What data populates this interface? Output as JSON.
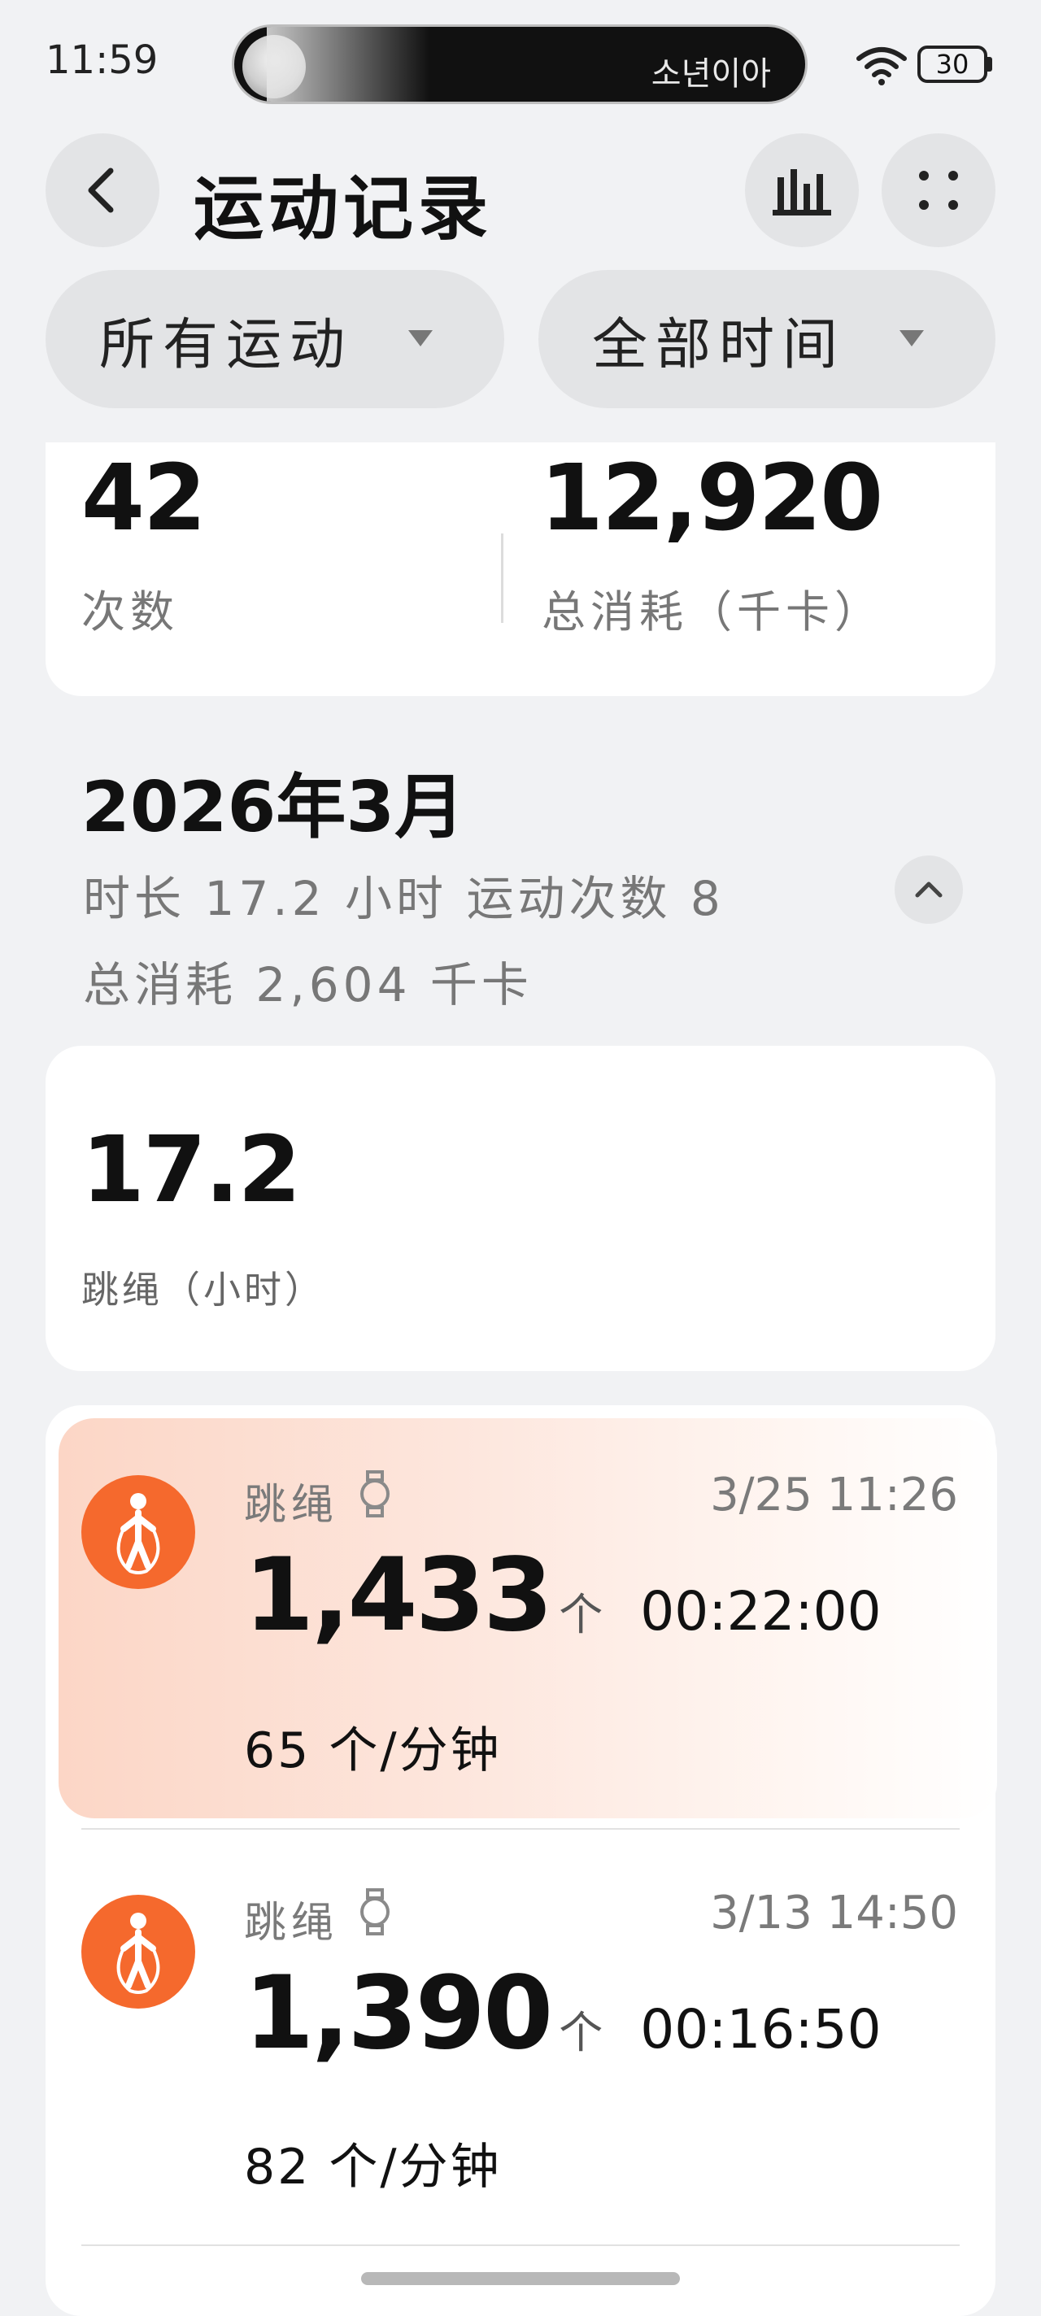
{
  "status_bar": {
    "time": "11:59",
    "island_text": "소년이아",
    "battery": "30"
  },
  "header": {
    "title": "运动记录",
    "back_icon": "chevron-left-icon",
    "chart_icon": "bar-chart-icon",
    "more_icon": "four-dots-icon"
  },
  "filters": {
    "sport": "所有运动",
    "time_range": "全部时间"
  },
  "summary": {
    "count_value": "42",
    "count_label": "次数",
    "calories_value": "12,920",
    "calories_label": "总消耗（千卡）"
  },
  "month": {
    "title": "2026年3月",
    "duration_line": "时长 17.2 小时  运动次数 8",
    "calories_line": "总消耗 2,604 千卡",
    "breakdown_value": "17.2",
    "breakdown_label": "跳绳（小时）"
  },
  "records": [
    {
      "sport": "跳绳",
      "datetime": "3/25 11:26",
      "count": "1,433",
      "unit": "个",
      "duration": "00:22:00",
      "rate": "65 个/分钟"
    },
    {
      "sport": "跳绳",
      "datetime": "3/13 14:50",
      "count": "1,390",
      "unit": "个",
      "duration": "00:16:50",
      "rate": "82 个/分钟"
    }
  ],
  "colors": {
    "accent": "#f5692d",
    "background": "#f1f2f4",
    "card": "#ffffff",
    "highlight": "#fcd6c6"
  }
}
